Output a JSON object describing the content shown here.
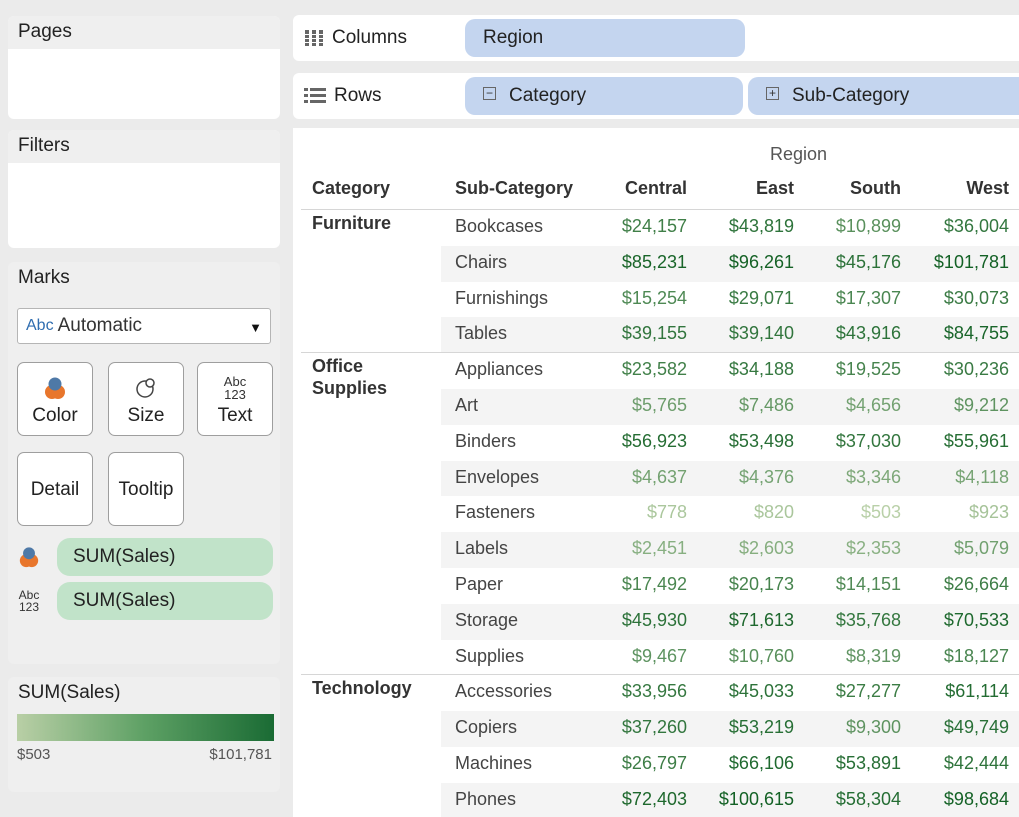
{
  "panels": {
    "pages_title": "Pages",
    "filters_title": "Filters",
    "marks_title": "Marks"
  },
  "marks": {
    "mark_type_prefix": "Abc",
    "mark_type": "Automatic",
    "buttons": {
      "color": "Color",
      "size": "Size",
      "text": "Text",
      "detail": "Detail",
      "tooltip": "Tooltip"
    },
    "text_icon_line1": "Abc",
    "text_icon_line2": "123",
    "pills": [
      "SUM(Sales)",
      "SUM(Sales)"
    ]
  },
  "legend": {
    "title": "SUM(Sales)",
    "min": "$503",
    "max": "$101,781",
    "color_min": "#b9cfa6",
    "color_max": "#1a6b34"
  },
  "shelves": {
    "columns_label": "Columns",
    "rows_label": "Rows",
    "columns_pill": "Region",
    "rows_pills": [
      "Category",
      "Sub-Category"
    ]
  },
  "crosstab": {
    "region_header": "Region",
    "headers": [
      "Category",
      "Sub-Category",
      "Central",
      "East",
      "South",
      "West"
    ],
    "groups": [
      {
        "category": "Furniture",
        "rows": [
          {
            "sub": "Bookcases",
            "values": [
              "$24,157",
              "$43,819",
              "$10,899",
              "$36,004"
            ]
          },
          {
            "sub": "Chairs",
            "values": [
              "$85,231",
              "$96,261",
              "$45,176",
              "$101,781"
            ]
          },
          {
            "sub": "Furnishings",
            "values": [
              "$15,254",
              "$29,071",
              "$17,307",
              "$30,073"
            ]
          },
          {
            "sub": "Tables",
            "values": [
              "$39,155",
              "$39,140",
              "$43,916",
              "$84,755"
            ]
          }
        ]
      },
      {
        "category": "Office Supplies",
        "rows": [
          {
            "sub": "Appliances",
            "values": [
              "$23,582",
              "$34,188",
              "$19,525",
              "$30,236"
            ]
          },
          {
            "sub": "Art",
            "values": [
              "$5,765",
              "$7,486",
              "$4,656",
              "$9,212"
            ]
          },
          {
            "sub": "Binders",
            "values": [
              "$56,923",
              "$53,498",
              "$37,030",
              "$55,961"
            ]
          },
          {
            "sub": "Envelopes",
            "values": [
              "$4,637",
              "$4,376",
              "$3,346",
              "$4,118"
            ]
          },
          {
            "sub": "Fasteners",
            "values": [
              "$778",
              "$820",
              "$503",
              "$923"
            ]
          },
          {
            "sub": "Labels",
            "values": [
              "$2,451",
              "$2,603",
              "$2,353",
              "$5,079"
            ]
          },
          {
            "sub": "Paper",
            "values": [
              "$17,492",
              "$20,173",
              "$14,151",
              "$26,664"
            ]
          },
          {
            "sub": "Storage",
            "values": [
              "$45,930",
              "$71,613",
              "$35,768",
              "$70,533"
            ]
          },
          {
            "sub": "Supplies",
            "values": [
              "$9,467",
              "$10,760",
              "$8,319",
              "$18,127"
            ]
          }
        ]
      },
      {
        "category": "Technology",
        "rows": [
          {
            "sub": "Accessories",
            "values": [
              "$33,956",
              "$45,033",
              "$27,277",
              "$61,114"
            ]
          },
          {
            "sub": "Copiers",
            "values": [
              "$37,260",
              "$53,219",
              "$9,300",
              "$49,749"
            ]
          },
          {
            "sub": "Machines",
            "values": [
              "$26,797",
              "$66,106",
              "$53,891",
              "$42,444"
            ]
          },
          {
            "sub": "Phones",
            "values": [
              "$72,403",
              "$100,615",
              "$58,304",
              "$98,684"
            ]
          }
        ]
      }
    ]
  },
  "colors": {
    "shelf_pill": "#c4d5ef",
    "measure_pill": "#c1e3c9",
    "text_light": "#b9d0a8",
    "text_dark": "#136125"
  }
}
